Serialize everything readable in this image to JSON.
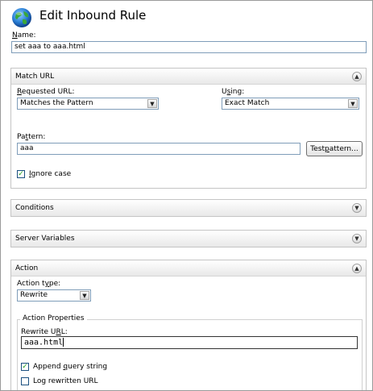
{
  "header": {
    "title": "Edit Inbound Rule"
  },
  "name_field": {
    "label": "Name:",
    "value": "set aaa to aaa.html"
  },
  "match_url": {
    "title": "Match URL",
    "requested_label": "Requested URL:",
    "requested_value": "Matches the Pattern",
    "using_label": "Using:",
    "using_value": "Exact Match",
    "pattern_label": "Pattern:",
    "pattern_value": "aaa",
    "test_button": "Test pattern...",
    "ignore_case_label": "Ignore case",
    "ignore_case_checked": true
  },
  "conditions": {
    "title": "Conditions"
  },
  "server_variables": {
    "title": "Server Variables"
  },
  "action": {
    "title": "Action",
    "type_label": "Action type:",
    "type_value": "Rewrite",
    "properties_title": "Action Properties",
    "rewrite_url_label": "Rewrite URL:",
    "rewrite_url_value": "aaa.html",
    "append_query_label": "Append query string",
    "append_query_checked": true,
    "log_url_label": "Log rewritten URL",
    "log_url_checked": false
  },
  "icons": {
    "globe": "globe-icon",
    "collapse": "chevron-up-icon",
    "expand": "chevron-down-icon",
    "dropdown": "dropdown-arrow-icon",
    "check": "checkmark-icon"
  },
  "colors": {
    "input_border": "#7f9db9",
    "panel_border": "#c5c5c5"
  }
}
